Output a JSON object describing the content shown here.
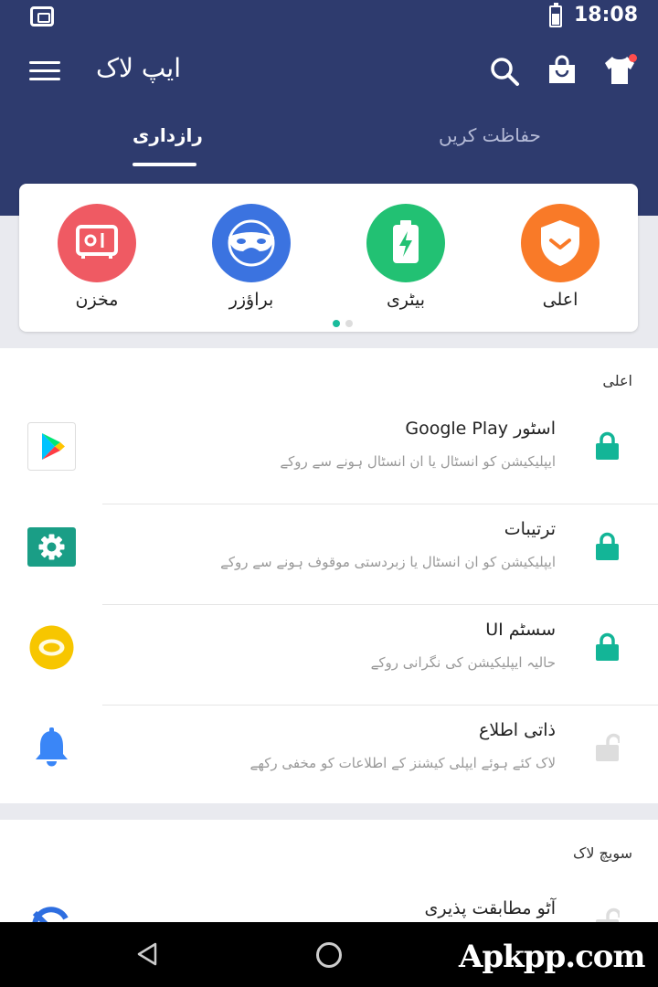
{
  "status_bar": {
    "time": "18:08"
  },
  "app_bar": {
    "title": "ایپ لاک"
  },
  "tabs": [
    {
      "label": "رازداری",
      "active": true
    },
    {
      "label": "حفاظت کریں",
      "active": false
    }
  ],
  "shortcuts": [
    {
      "label": "مخزن",
      "icon": "vault-icon",
      "color": "#ef5a63"
    },
    {
      "label": "براؤزر",
      "icon": "mask-browser-icon",
      "color": "#3b73e0"
    },
    {
      "label": "بیٹری",
      "icon": "battery-icon",
      "color": "#22c173"
    },
    {
      "label": "اعلی",
      "icon": "shield-icon",
      "color": "#f97a28"
    }
  ],
  "sections": [
    {
      "header": "اعلی",
      "rows": [
        {
          "title": "اسٹور Google Play",
          "subtitle": "ایپلیکیشن کو انسٹال یا ان انسٹال ہونے سے روکے",
          "icon": "google-play-icon",
          "locked": true
        },
        {
          "title": "ترتیبات",
          "subtitle": "ایپلیکیشن کو ان انسٹال یا زبردستی موقوف ہونے سے روکے",
          "icon": "settings-gear-icon",
          "locked": true
        },
        {
          "title": "سسٹم UI",
          "subtitle": "حالیہ ایپلیکیشن کی نگرانی روکے",
          "icon": "system-ui-icon",
          "locked": true
        },
        {
          "title": "ذاتی اطلاع",
          "subtitle": "لاک کئے ہوئے ایپلی کیشنز کے اطلاعات کو مخفی رکھے",
          "icon": "bell-icon",
          "locked": false
        }
      ]
    },
    {
      "header": "سویچ لاک",
      "rows": [
        {
          "title": "آٹو مطابقت پذیری",
          "icon": "sync-icon",
          "locked": false
        }
      ]
    }
  ],
  "watermark": "Apkpp.com",
  "colors": {
    "header": "#2e3b6e",
    "accent": "#1abc9c",
    "lock_on": "#13b597",
    "lock_off": "#dddddd"
  }
}
